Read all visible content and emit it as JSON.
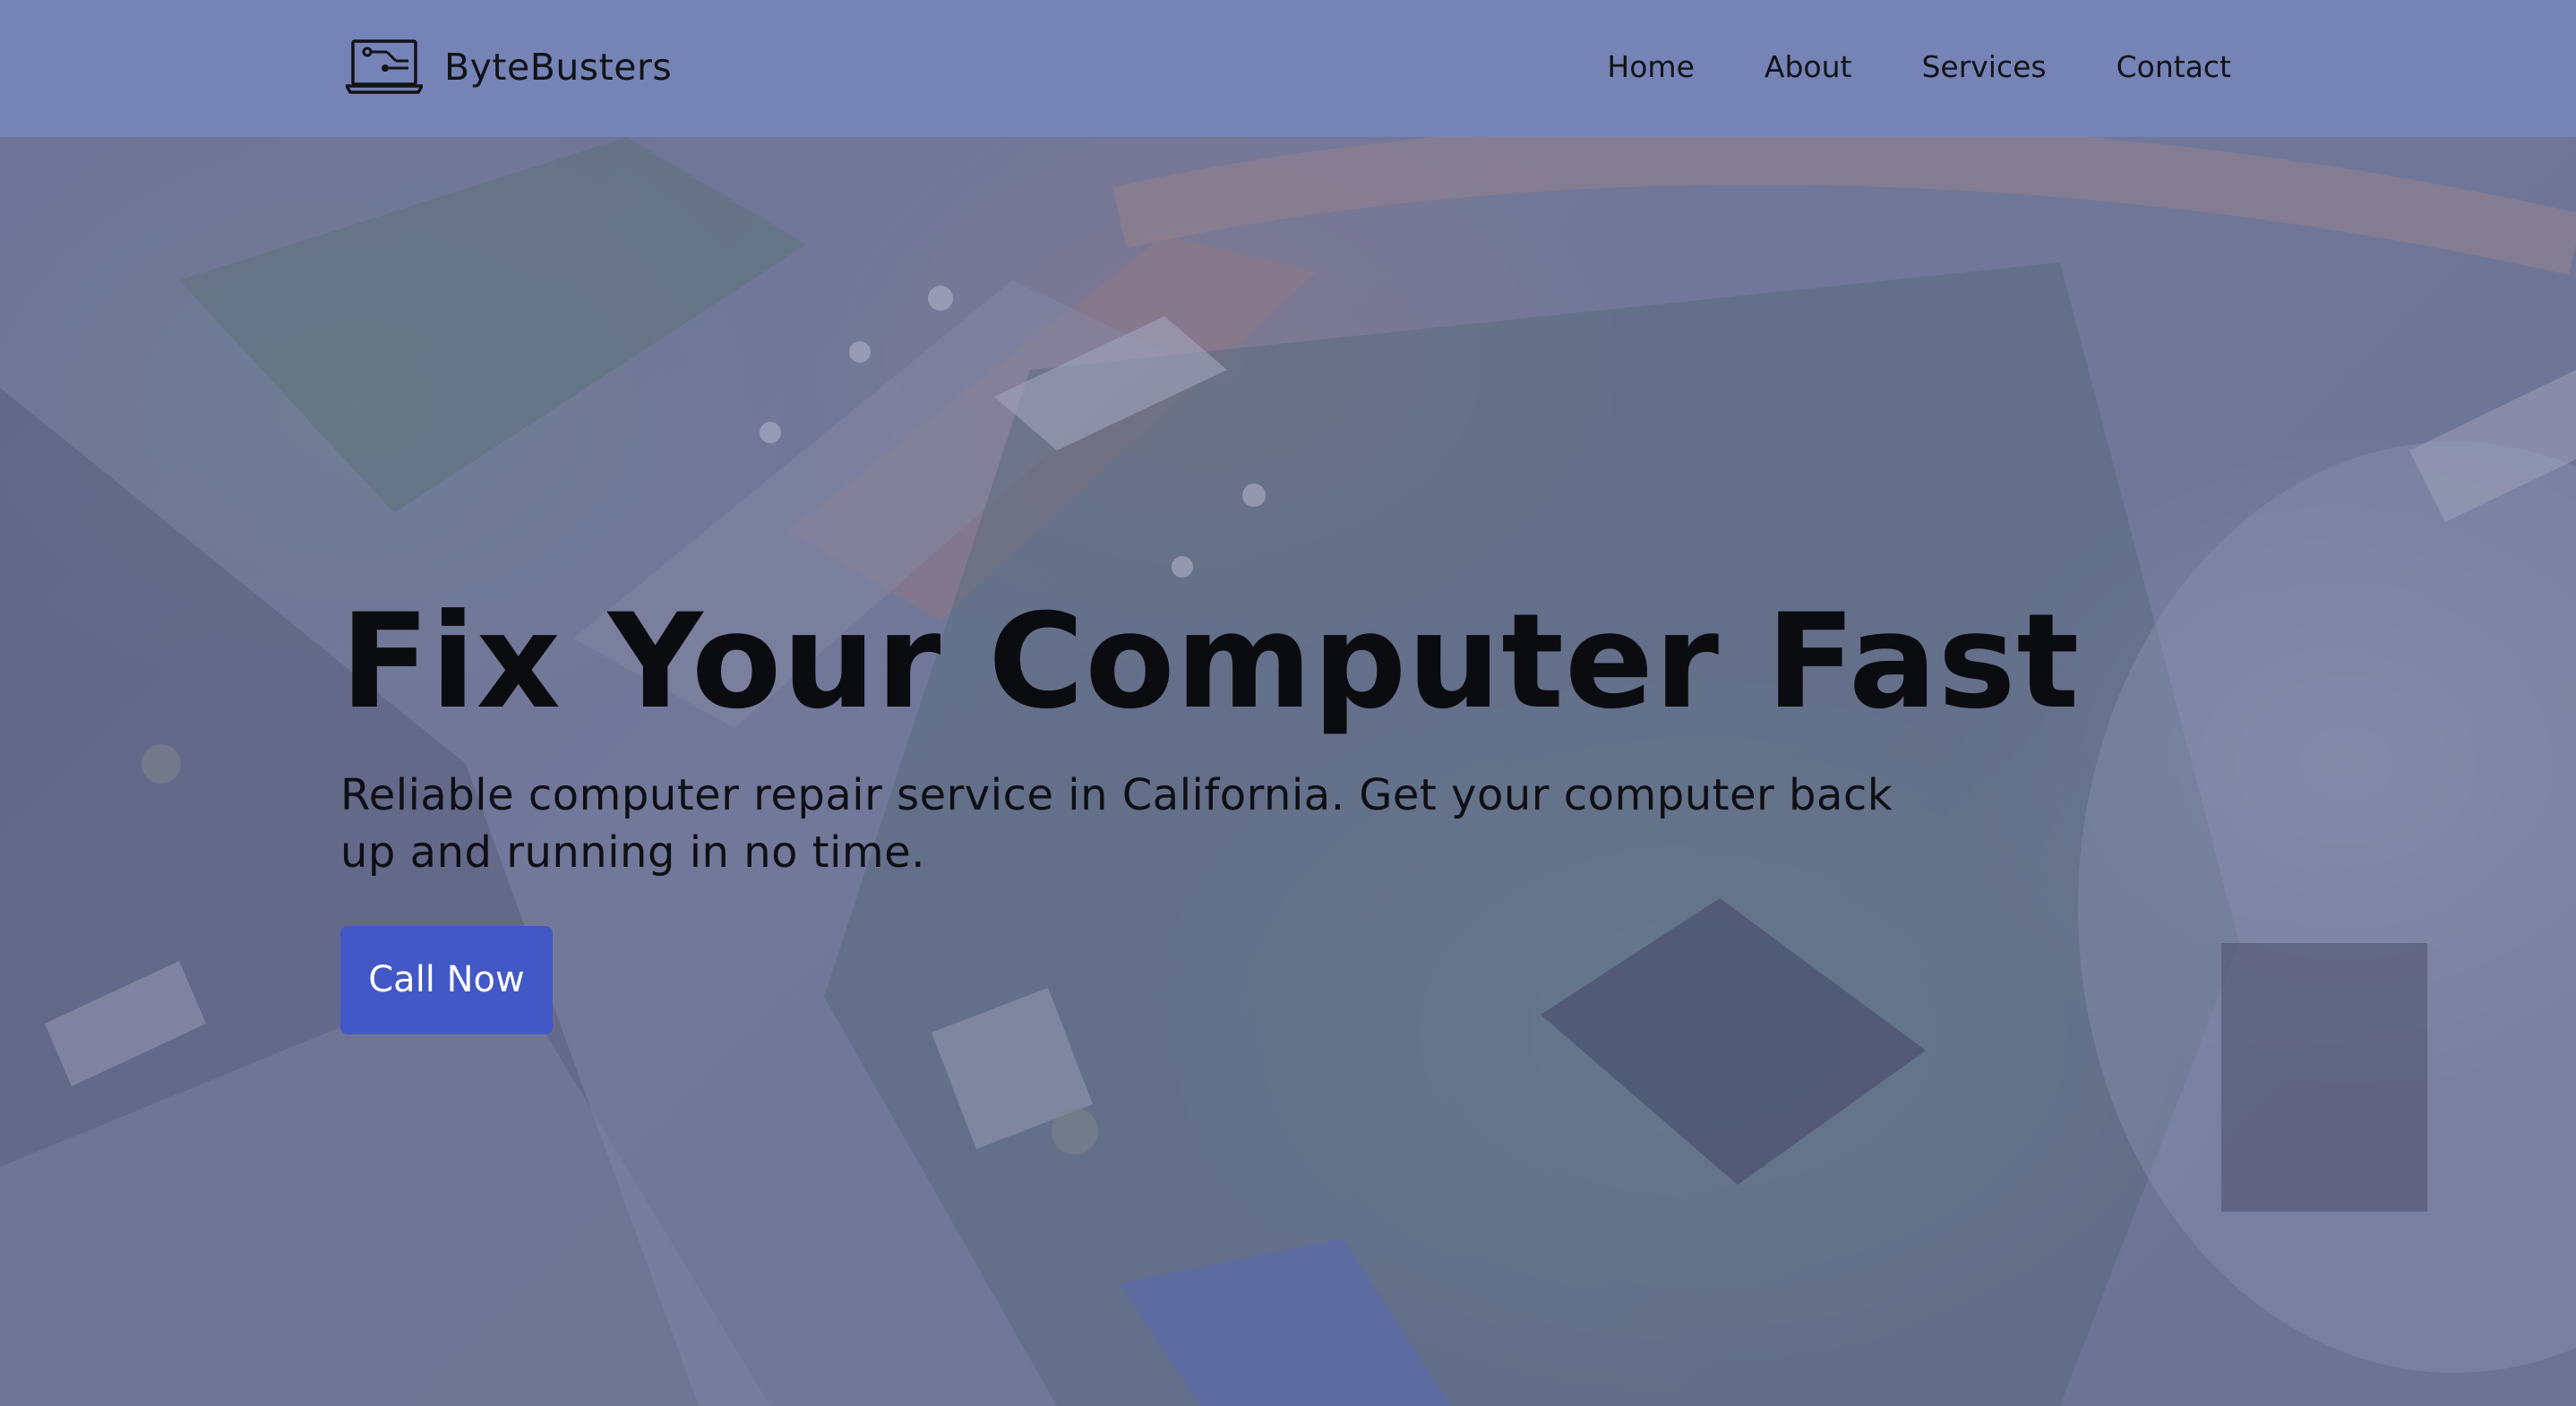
{
  "header": {
    "brand_name": "ByteBusters",
    "logo_icon": "laptop-repair-icon",
    "nav": [
      {
        "label": "Home"
      },
      {
        "label": "About"
      },
      {
        "label": "Services"
      },
      {
        "label": "Contact"
      }
    ],
    "background_color": "#7583b6"
  },
  "hero": {
    "background_image": "computer-motherboard-photo",
    "title": "Fix Your Computer Fast",
    "subtitle": "Reliable computer repair service in California. Get your computer back up and running in no time.",
    "cta_label": "Call Now",
    "cta_color": "#4258c6"
  }
}
